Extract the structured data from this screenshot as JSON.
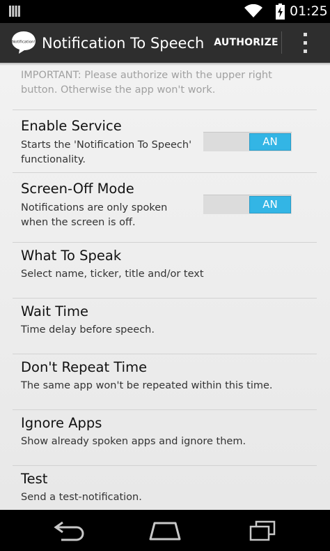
{
  "status_bar": {
    "time": "01:25"
  },
  "action_bar": {
    "icon_text": "Notification!",
    "title": "Notification To Speech",
    "authorize_label": "AUTHORIZE"
  },
  "notice": "IMPORTANT: Please authorize with the upper right button. Otherwise the app won't work.",
  "preferences": [
    {
      "title": "Enable Service",
      "summary": "Starts the 'Notification To Speech' functionality.",
      "toggle": "AN"
    },
    {
      "title": "Screen-Off Mode",
      "summary": "Notifications are only spoken when the screen is off.",
      "toggle": "AN"
    },
    {
      "title": "What To Speak",
      "summary": "Select name, ticker, title and/or text"
    },
    {
      "title": "Wait Time",
      "summary": "Time delay before speech."
    },
    {
      "title": "Don't Repeat Time",
      "summary": "The same app won't be repeated within this time."
    },
    {
      "title": "Ignore Apps",
      "summary": "Show already spoken apps and ignore them."
    },
    {
      "title": "Test",
      "summary": "Send a test-notification."
    }
  ],
  "colors": {
    "accent": "#33b5e5",
    "action_bar": "#2e2e2e",
    "background": "#f0f0f0"
  }
}
